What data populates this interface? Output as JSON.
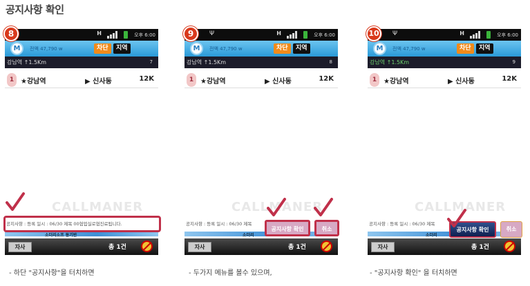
{
  "page_title": "공지사항 확인",
  "panels": [
    {
      "step": "8",
      "status": {
        "network": "H",
        "time": "오후 6:00"
      },
      "appbar": {
        "balance": "전액 47,790 w",
        "block_label": "차단",
        "region_label": "지역"
      },
      "location": {
        "text": "강남역 ↑1.5Km",
        "count": "7"
      },
      "row": {
        "index": "1",
        "from": "★강남역",
        "to": "▶ 신사동",
        "distance": "12K"
      },
      "watermark": "CALLMANER",
      "notice": "공지사항 : 등록 일시 : 06/30 제목 00협업실로협진료됩니다.",
      "blue_text": "소더리소프 동기반",
      "bottom": {
        "jasa": "자사",
        "total": "총 1건"
      },
      "caption": "- 하단 \"공지사항\"을 터치하면"
    },
    {
      "step": "9",
      "status": {
        "network": "H",
        "time": "오후 6:00"
      },
      "appbar": {
        "balance": "전액 47,790 w",
        "block_label": "차단",
        "region_label": "지역"
      },
      "location": {
        "text": "강남역 ↑1.5Km",
        "count": "8"
      },
      "row": {
        "index": "1",
        "from": "★강남역",
        "to": "▶ 신사동",
        "distance": "12K"
      },
      "watermark": "CALLMANER",
      "notice": "공지사항 : 등록 일시 : 06/30 제목",
      "confirm_label": "공지사항 확인",
      "cancel_label": "취소",
      "blue_text": "소더리",
      "bottom": {
        "jasa": "자사",
        "total": "총 1건"
      },
      "caption": "- 두가지 메뉴를 볼수 있으며,"
    },
    {
      "step": "10",
      "status": {
        "network": "H",
        "time": "오후 6:00"
      },
      "appbar": {
        "balance": "전액 47,790 w",
        "block_label": "차단",
        "region_label": "지역"
      },
      "location": {
        "text": "강남역 ↑1.5Km",
        "count": "9"
      },
      "row": {
        "index": "1",
        "from": "★강남역",
        "to": "▶ 신사동",
        "distance": "12K"
      },
      "watermark": "CALLMANER",
      "notice": "공지사항 : 등록 일시 : 06/30 제목",
      "confirm_label": "공지사항 확인",
      "cancel_label": "취소",
      "blue_text": "소더리",
      "bottom": {
        "jasa": "자사",
        "total": "총 1건"
      },
      "caption": "- \"공지사항 확인\" 을 터치하면"
    }
  ],
  "colors": {
    "accent": "#d9391c",
    "highlight": "#c0304a",
    "appbar": "#2a9ad8",
    "block_button": "#f08a1a"
  }
}
